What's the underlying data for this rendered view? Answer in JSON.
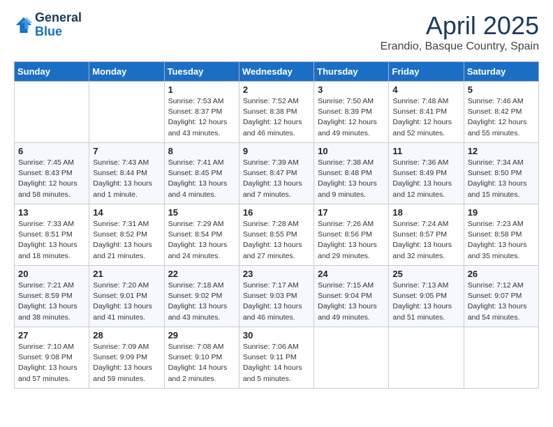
{
  "header": {
    "logo_line1": "General",
    "logo_line2": "Blue",
    "month": "April 2025",
    "location": "Erandio, Basque Country, Spain"
  },
  "weekdays": [
    "Sunday",
    "Monday",
    "Tuesday",
    "Wednesday",
    "Thursday",
    "Friday",
    "Saturday"
  ],
  "weeks": [
    [
      {
        "day": "",
        "info": ""
      },
      {
        "day": "",
        "info": ""
      },
      {
        "day": "1",
        "info": "Sunrise: 7:53 AM\nSunset: 8:37 PM\nDaylight: 12 hours and 43 minutes."
      },
      {
        "day": "2",
        "info": "Sunrise: 7:52 AM\nSunset: 8:38 PM\nDaylight: 12 hours and 46 minutes."
      },
      {
        "day": "3",
        "info": "Sunrise: 7:50 AM\nSunset: 8:39 PM\nDaylight: 12 hours and 49 minutes."
      },
      {
        "day": "4",
        "info": "Sunrise: 7:48 AM\nSunset: 8:41 PM\nDaylight: 12 hours and 52 minutes."
      },
      {
        "day": "5",
        "info": "Sunrise: 7:46 AM\nSunset: 8:42 PM\nDaylight: 12 hours and 55 minutes."
      }
    ],
    [
      {
        "day": "6",
        "info": "Sunrise: 7:45 AM\nSunset: 8:43 PM\nDaylight: 12 hours and 58 minutes."
      },
      {
        "day": "7",
        "info": "Sunrise: 7:43 AM\nSunset: 8:44 PM\nDaylight: 13 hours and 1 minute."
      },
      {
        "day": "8",
        "info": "Sunrise: 7:41 AM\nSunset: 8:45 PM\nDaylight: 13 hours and 4 minutes."
      },
      {
        "day": "9",
        "info": "Sunrise: 7:39 AM\nSunset: 8:47 PM\nDaylight: 13 hours and 7 minutes."
      },
      {
        "day": "10",
        "info": "Sunrise: 7:38 AM\nSunset: 8:48 PM\nDaylight: 13 hours and 9 minutes."
      },
      {
        "day": "11",
        "info": "Sunrise: 7:36 AM\nSunset: 8:49 PM\nDaylight: 13 hours and 12 minutes."
      },
      {
        "day": "12",
        "info": "Sunrise: 7:34 AM\nSunset: 8:50 PM\nDaylight: 13 hours and 15 minutes."
      }
    ],
    [
      {
        "day": "13",
        "info": "Sunrise: 7:33 AM\nSunset: 8:51 PM\nDaylight: 13 hours and 18 minutes."
      },
      {
        "day": "14",
        "info": "Sunrise: 7:31 AM\nSunset: 8:52 PM\nDaylight: 13 hours and 21 minutes."
      },
      {
        "day": "15",
        "info": "Sunrise: 7:29 AM\nSunset: 8:54 PM\nDaylight: 13 hours and 24 minutes."
      },
      {
        "day": "16",
        "info": "Sunrise: 7:28 AM\nSunset: 8:55 PM\nDaylight: 13 hours and 27 minutes."
      },
      {
        "day": "17",
        "info": "Sunrise: 7:26 AM\nSunset: 8:56 PM\nDaylight: 13 hours and 29 minutes."
      },
      {
        "day": "18",
        "info": "Sunrise: 7:24 AM\nSunset: 8:57 PM\nDaylight: 13 hours and 32 minutes."
      },
      {
        "day": "19",
        "info": "Sunrise: 7:23 AM\nSunset: 8:58 PM\nDaylight: 13 hours and 35 minutes."
      }
    ],
    [
      {
        "day": "20",
        "info": "Sunrise: 7:21 AM\nSunset: 8:59 PM\nDaylight: 13 hours and 38 minutes."
      },
      {
        "day": "21",
        "info": "Sunrise: 7:20 AM\nSunset: 9:01 PM\nDaylight: 13 hours and 41 minutes."
      },
      {
        "day": "22",
        "info": "Sunrise: 7:18 AM\nSunset: 9:02 PM\nDaylight: 13 hours and 43 minutes."
      },
      {
        "day": "23",
        "info": "Sunrise: 7:17 AM\nSunset: 9:03 PM\nDaylight: 13 hours and 46 minutes."
      },
      {
        "day": "24",
        "info": "Sunrise: 7:15 AM\nSunset: 9:04 PM\nDaylight: 13 hours and 49 minutes."
      },
      {
        "day": "25",
        "info": "Sunrise: 7:13 AM\nSunset: 9:05 PM\nDaylight: 13 hours and 51 minutes."
      },
      {
        "day": "26",
        "info": "Sunrise: 7:12 AM\nSunset: 9:07 PM\nDaylight: 13 hours and 54 minutes."
      }
    ],
    [
      {
        "day": "27",
        "info": "Sunrise: 7:10 AM\nSunset: 9:08 PM\nDaylight: 13 hours and 57 minutes."
      },
      {
        "day": "28",
        "info": "Sunrise: 7:09 AM\nSunset: 9:09 PM\nDaylight: 13 hours and 59 minutes."
      },
      {
        "day": "29",
        "info": "Sunrise: 7:08 AM\nSunset: 9:10 PM\nDaylight: 14 hours and 2 minutes."
      },
      {
        "day": "30",
        "info": "Sunrise: 7:06 AM\nSunset: 9:11 PM\nDaylight: 14 hours and 5 minutes."
      },
      {
        "day": "",
        "info": ""
      },
      {
        "day": "",
        "info": ""
      },
      {
        "day": "",
        "info": ""
      }
    ]
  ]
}
